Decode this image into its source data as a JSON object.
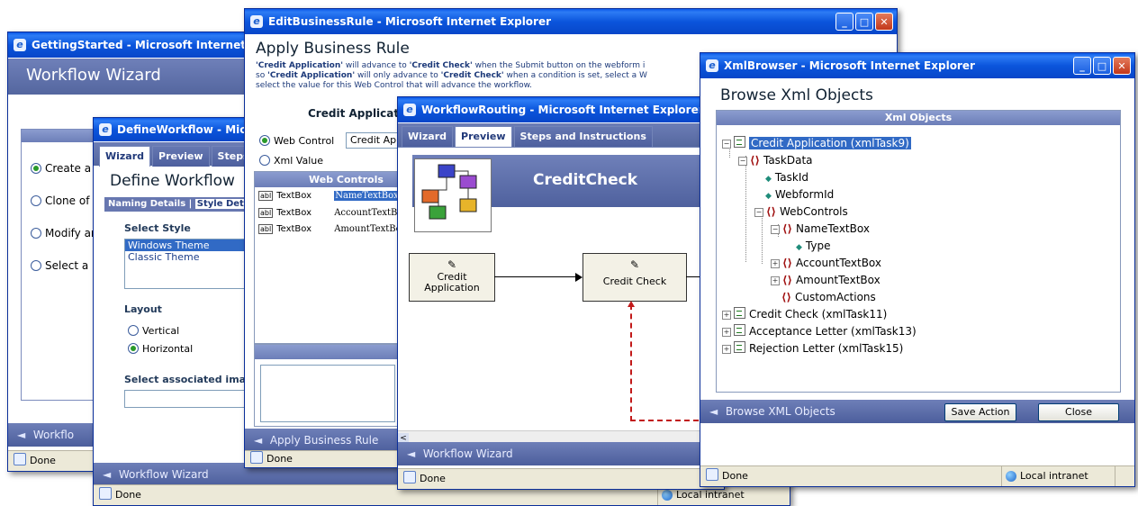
{
  "win_getting_started": {
    "title": "GettingStarted - Microsoft Internet E",
    "app_title": "Workflow Wizard",
    "options": [
      "Create a",
      "Clone of",
      "Modify ar",
      "Select a"
    ],
    "footer": "Workflo",
    "status": "Done"
  },
  "win_define_workflow": {
    "title": "DefineWorkflow - Microso",
    "tabs": [
      "Wizard",
      "Preview",
      "Steps"
    ],
    "heading": "Define Workflow",
    "subtabs": [
      "Naming Details",
      "|",
      "Style Det"
    ],
    "select_style_label": "Select Style",
    "styles": [
      "Windows Theme",
      "Classic Theme"
    ],
    "layout_label": "Layout",
    "layout_options": [
      "Vertical",
      "Horizontal"
    ],
    "image_label": "Select associated ima",
    "footer": "Workflow Wizard",
    "status": "Done",
    "zone": "Local intranet"
  },
  "win_edit_business_rule": {
    "title": "EditBusinessRule - Microsoft Internet Explorer",
    "heading": "Apply Business Rule",
    "desc_line1_a": "'Credit Application'",
    "desc_line1_b": " will advance to ",
    "desc_line1_c": "'Credit Check'",
    "desc_line1_d": " when the Submit button on the webform i",
    "desc_line2_a": "so ",
    "desc_line2_b": "'Credit Application'",
    "desc_line2_c": " will only advance to ",
    "desc_line2_d": "'Credit Check'",
    "desc_line2_e": " when a condition is set, select a W",
    "desc_line3": "select the value for this Web Control that will advance the workflow.",
    "rule_label": "Credit Applicati",
    "radio_web": "Web Control",
    "radio_xml": "Xml Value",
    "dropdown_value": "Credit App",
    "grid_header": "Web Controls",
    "rows": [
      {
        "type": "TextBox",
        "name": "NameTextBox"
      },
      {
        "type": "TextBox",
        "name": "AccountTextBo"
      },
      {
        "type": "TextBox",
        "name": "AmountTextBo"
      }
    ],
    "abl_icon": "abl",
    "footer": "Apply Business Rule",
    "status": "Done"
  },
  "win_workflow_routing": {
    "title": "WorkflowRouting - Microsoft Internet Explorer",
    "tabs": [
      "Wizard",
      "Preview",
      "Steps and Instructions"
    ],
    "banner": "CreditCheck",
    "node1": "Credit\nApplication",
    "node2": "Credit Check",
    "footer": "Workflow Wizard",
    "status": "Done",
    "scroll_left": "<"
  },
  "win_xml_browser": {
    "title": "XmlBrowser - Microsoft Internet Explorer",
    "heading": "Browse Xml Objects",
    "panel_header": "Xml Objects",
    "tree": {
      "root": "Credit Application (xmlTask9)",
      "taskdata": "TaskData",
      "taskid": "TaskId",
      "webformid": "WebformId",
      "webcontrols": "WebControls",
      "nametextbox": "NameTextBox",
      "type": "Type",
      "accounttextbox": "AccountTextBox",
      "amounttextbox": "AmountTextBox",
      "customactions": "CustomActions",
      "creditcheck": "Credit Check (xmlTask11)",
      "acceptance": "Acceptance Letter (xmlTask13)",
      "rejection": "Rejection Letter (xmlTask15)"
    },
    "footer": "Browse XML Objects",
    "save_button": "Save Action",
    "close_button": "Close",
    "status": "Done",
    "zone": "Local intranet"
  },
  "glyphs": {
    "ie": "e",
    "min": "_",
    "max": "□",
    "close": "✕",
    "plus": "+",
    "minus": "−",
    "el": "⟨⟩",
    "at": "◆",
    "arrow": "◄",
    "pen": "✎"
  },
  "colors": {
    "titlebar": "#0b55dc",
    "footer": "#5a6ca8",
    "accent_green": "#2a9a2a"
  }
}
